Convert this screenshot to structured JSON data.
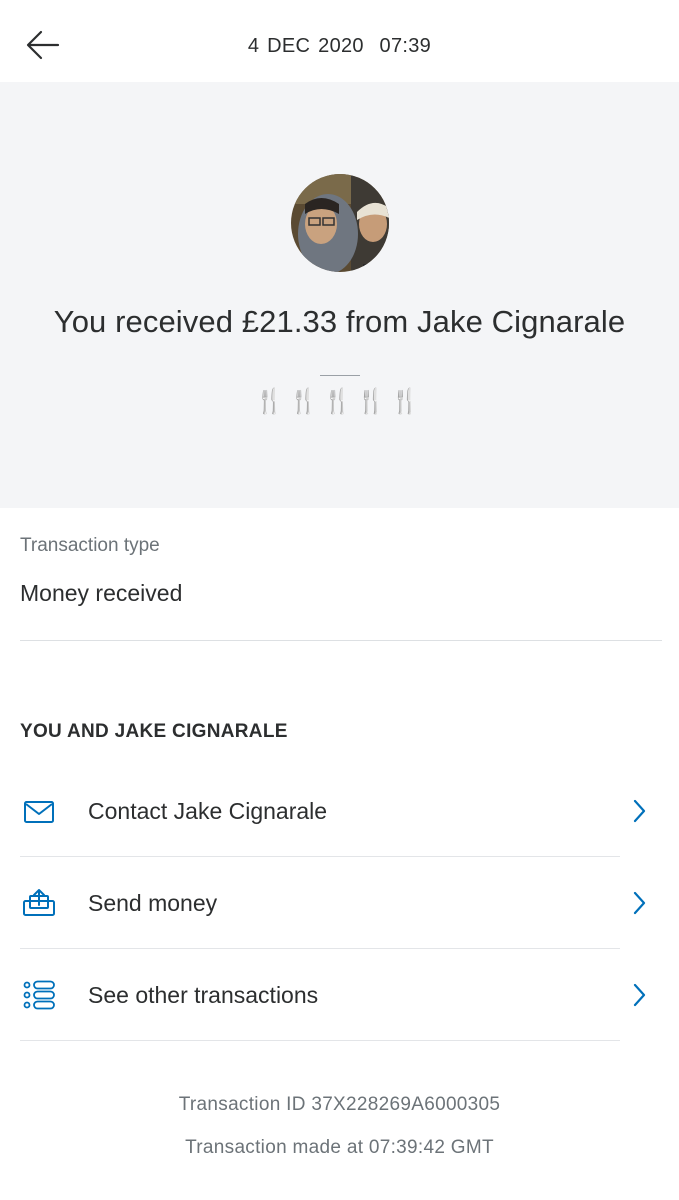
{
  "header": {
    "back_icon": "arrow-left-icon",
    "datetime": "4 DEC 2020  07:39"
  },
  "hero": {
    "title": "You received £21.33 from Jake Cignarale",
    "note": "🍴🍴🍴🍴🍴",
    "background": "#f4f5f7"
  },
  "details": {
    "type_label": "Transaction type",
    "type_value": "Money received"
  },
  "section": {
    "heading": "YOU AND JAKE CIGNARALE",
    "actions": [
      {
        "label": "Contact Jake Cignarale",
        "icon": "envelope-icon"
      },
      {
        "label": "Send money",
        "icon": "send-money-icon"
      },
      {
        "label": "See other transactions",
        "icon": "list-icon"
      }
    ]
  },
  "footer": {
    "transaction_id": "Transaction ID 37X228269A6000305",
    "made_at": "Transaction made at 07:39:42 GMT"
  },
  "colors": {
    "accent": "#0070ba",
    "text": "#2c2e2f",
    "muted": "#6c7378"
  }
}
